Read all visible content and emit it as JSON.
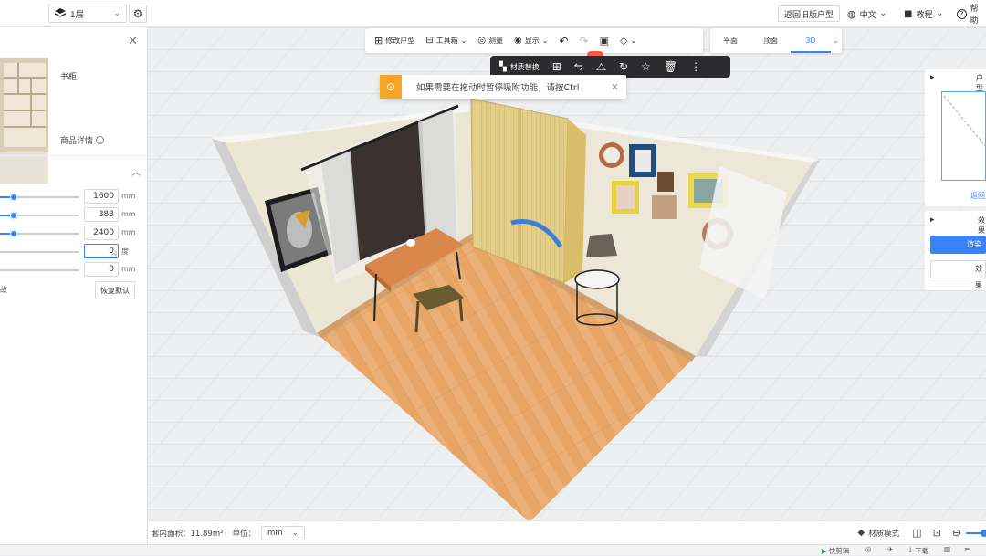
{
  "topbar": {
    "floor_label": "1层",
    "old_version_label": "返回旧版户型",
    "lang_label": "中文",
    "tutorial_label": "教程",
    "help_label": "帮助"
  },
  "left_panel": {
    "product_name": "书柜",
    "product_detail_label": "商品详情",
    "params": [
      {
        "value": "1600",
        "unit": "mm"
      },
      {
        "value": "383",
        "unit": "mm"
      },
      {
        "value": "2400",
        "unit": "mm"
      },
      {
        "value": "0",
        "unit": "度"
      },
      {
        "value": "0",
        "unit": "mm"
      }
    ],
    "param_frag_label": "故",
    "reset_label": "恢复默认"
  },
  "toolbar": {
    "edit_layout": "修改户型",
    "toolbox": "工具箱",
    "measure": "测量",
    "display": "显示"
  },
  "view_tabs": [
    "平面",
    "顶面",
    "3D"
  ],
  "selection_bar": {
    "material_replace": "材质替换"
  },
  "toast": {
    "message": "如果需要在拖动时暂停吸附功能，请按Ctrl"
  },
  "right_panel": {
    "panel1_title": "户型",
    "panel1_link": "返回",
    "panel2_title": "效果",
    "btn1": "渲染",
    "btn2": "效果"
  },
  "bottombar": {
    "area_text": "套内面积：11.89m²",
    "unit_label": "单位：",
    "unit_value": "mm",
    "material_mode": "材质模式"
  },
  "statusbar": {
    "quick_clip": "快剪辑",
    "download": "下载"
  },
  "colors": {
    "accent": "#3a83f7",
    "warning": "#f5a623",
    "dark_toolbar": "#2c2c2e"
  }
}
